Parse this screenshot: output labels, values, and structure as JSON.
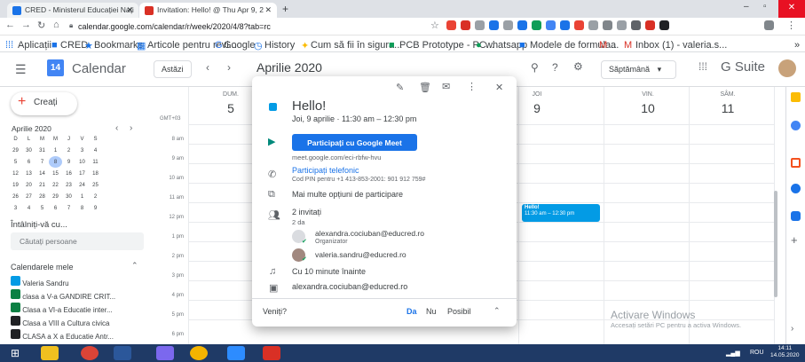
{
  "browser": {
    "tab1": "CRED - Ministerul Educației Nați",
    "tab2": "Invitation: Hello! @ Thu Apr 9, 2",
    "url": "calendar.google.com/calendar/r/week/2020/4/8?tab=rc",
    "bookmarks": [
      "Aplicații",
      "CRED",
      "Bookmarks",
      "Articole pentru revi...",
      "Google",
      "History",
      "Cum să fii în sigura...",
      "PCB Prototype - PC...",
      "whatsapp",
      "Modele de formula...",
      "a",
      "Inbox (1) - valeria.s..."
    ]
  },
  "header": {
    "app_icon_day": "14",
    "app_name": "Calendar",
    "today_btn": "Astăzi",
    "period": "Aprilie 2020",
    "view_select": "Săptămână",
    "brand": "G Suite"
  },
  "sidebar": {
    "create": "Creați",
    "mini_month": "Aprilie 2020",
    "weekdays": [
      "D",
      "L",
      "M",
      "M",
      "J",
      "V",
      "S"
    ],
    "weeks": [
      [
        "29",
        "30",
        "31",
        "1",
        "2",
        "3",
        "4"
      ],
      [
        "5",
        "6",
        "7",
        "8",
        "9",
        "10",
        "11"
      ],
      [
        "12",
        "13",
        "14",
        "15",
        "16",
        "17",
        "18"
      ],
      [
        "19",
        "20",
        "21",
        "22",
        "23",
        "24",
        "25"
      ],
      [
        "26",
        "27",
        "28",
        "29",
        "30",
        "1",
        "2"
      ],
      [
        "3",
        "4",
        "5",
        "6",
        "7",
        "8",
        "9"
      ]
    ],
    "meet_title": "Întâlniți-vă cu...",
    "search_people": "Căutați persoane",
    "my_calendars": "Calendarele mele",
    "calendars": [
      {
        "name": "Valeria Sandru",
        "color": "#039be5"
      },
      {
        "name": "clasa a V-a GANDIRE CRIT...",
        "color": "#0b8043"
      },
      {
        "name": "Clasa a VI-a Educatie inter...",
        "color": "#0b8043"
      },
      {
        "name": "Clasa a VIII a Cultura civica",
        "color": "#202124"
      },
      {
        "name": "CLASA a X a Educatie Antr...",
        "color": "#202124"
      }
    ]
  },
  "week": {
    "timezone": "GMT+03",
    "days": [
      {
        "name": "DUM.",
        "num": "5"
      },
      {
        "name": "JOI",
        "num": "9"
      },
      {
        "name": "VIN.",
        "num": "10"
      },
      {
        "name": "SÂM.",
        "num": "11"
      }
    ],
    "hours": [
      "8 am",
      "9 am",
      "10 am",
      "11 am",
      "12 pm",
      "1 pm",
      "2 pm",
      "3 pm",
      "4 pm",
      "5 pm",
      "6 pm"
    ],
    "event_title": "Hello!",
    "event_time": "11:30 am – 12:30 pm"
  },
  "popup": {
    "title": "Hello!",
    "datetime": "Joi, 9 aprilie · 11:30 am – 12:30 pm",
    "meet_button": "Participați cu Google Meet",
    "meet_link": "meet.google.com/eci-rbfw-hvu",
    "phone_title": "Participați telefonic",
    "phone_pin": "Cod PIN pentru +1 413-853-2001: 901 912 759#",
    "more_options": "Mai multe opțiuni de participare",
    "guests_count": "2 invitați",
    "guests_yes": "2 da",
    "guest1_email": "alexandra.cociuban@educred.ro",
    "guest1_role": "Organizator",
    "guest2_email": "valeria.sandru@educred.ro",
    "reminder": "Cu 10 minute înainte",
    "calendar_owner": "alexandra.cociuban@educred.ro",
    "rsvp_question": "Veniți?",
    "rsvp_yes": "Da",
    "rsvp_no": "Nu",
    "rsvp_maybe": "Posibil"
  },
  "watermark": {
    "line1": "Activare Windows",
    "line2": "Accesați setări PC pentru a activa Windows."
  },
  "taskbar": {
    "lang": "ROU",
    "time": "14:11",
    "date": "14.05.2020"
  }
}
